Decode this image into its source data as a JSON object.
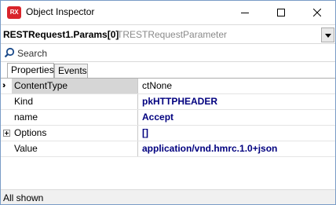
{
  "window": {
    "title": "Object Inspector",
    "logo_text": "RX"
  },
  "object_selector": {
    "name": "RESTRequest1.Params[0]",
    "type": "TRESTRequestParameter"
  },
  "search": {
    "placeholder": "Search",
    "value": ""
  },
  "tabs": [
    {
      "label": "Properties",
      "active": true
    },
    {
      "label": "Events",
      "active": false
    }
  ],
  "properties": [
    {
      "name": "ContentType",
      "value": "ctNone",
      "selected": true,
      "expandable": false
    },
    {
      "name": "Kind",
      "value": "pkHTTPHEADER",
      "selected": false,
      "expandable": false
    },
    {
      "name": "name",
      "value": "Accept",
      "selected": false,
      "expandable": false
    },
    {
      "name": "Options",
      "value": "[]",
      "selected": false,
      "expandable": true
    },
    {
      "name": "Value",
      "value": "application/vnd.hmrc.1.0+json",
      "selected": false,
      "expandable": false
    }
  ],
  "status": {
    "text": "All shown"
  },
  "colors": {
    "logo_bg": "#d9242b",
    "value_text": "#00007f",
    "selected_row_bg": "#d6d6d6"
  },
  "icons": {
    "search": "search-icon",
    "selected_row_marker": "selected-row-arrow-icon",
    "expand": "plus-box-icon",
    "dropdown": "chevron-down-icon"
  }
}
